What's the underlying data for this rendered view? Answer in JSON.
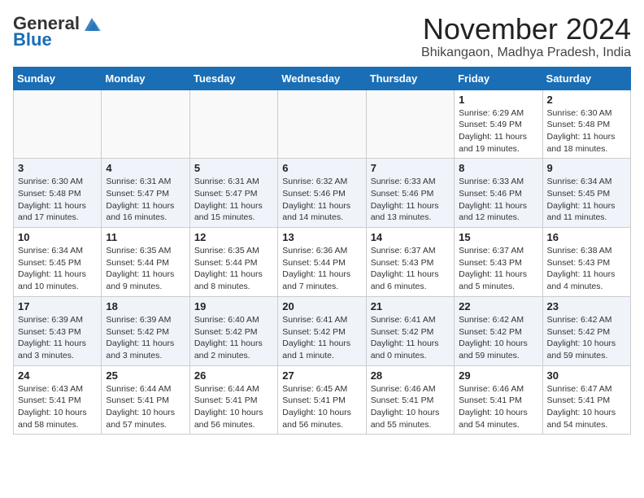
{
  "header": {
    "logo_general": "General",
    "logo_blue": "Blue",
    "month_title": "November 2024",
    "location": "Bhikangaon, Madhya Pradesh, India"
  },
  "days_of_week": [
    "Sunday",
    "Monday",
    "Tuesday",
    "Wednesday",
    "Thursday",
    "Friday",
    "Saturday"
  ],
  "weeks": [
    [
      {
        "day": "",
        "sunrise": "",
        "sunset": "",
        "daylight": ""
      },
      {
        "day": "",
        "sunrise": "",
        "sunset": "",
        "daylight": ""
      },
      {
        "day": "",
        "sunrise": "",
        "sunset": "",
        "daylight": ""
      },
      {
        "day": "",
        "sunrise": "",
        "sunset": "",
        "daylight": ""
      },
      {
        "day": "",
        "sunrise": "",
        "sunset": "",
        "daylight": ""
      },
      {
        "day": "1",
        "sunrise": "Sunrise: 6:29 AM",
        "sunset": "Sunset: 5:49 PM",
        "daylight": "Daylight: 11 hours and 19 minutes."
      },
      {
        "day": "2",
        "sunrise": "Sunrise: 6:30 AM",
        "sunset": "Sunset: 5:48 PM",
        "daylight": "Daylight: 11 hours and 18 minutes."
      }
    ],
    [
      {
        "day": "3",
        "sunrise": "Sunrise: 6:30 AM",
        "sunset": "Sunset: 5:48 PM",
        "daylight": "Daylight: 11 hours and 17 minutes."
      },
      {
        "day": "4",
        "sunrise": "Sunrise: 6:31 AM",
        "sunset": "Sunset: 5:47 PM",
        "daylight": "Daylight: 11 hours and 16 minutes."
      },
      {
        "day": "5",
        "sunrise": "Sunrise: 6:31 AM",
        "sunset": "Sunset: 5:47 PM",
        "daylight": "Daylight: 11 hours and 15 minutes."
      },
      {
        "day": "6",
        "sunrise": "Sunrise: 6:32 AM",
        "sunset": "Sunset: 5:46 PM",
        "daylight": "Daylight: 11 hours and 14 minutes."
      },
      {
        "day": "7",
        "sunrise": "Sunrise: 6:33 AM",
        "sunset": "Sunset: 5:46 PM",
        "daylight": "Daylight: 11 hours and 13 minutes."
      },
      {
        "day": "8",
        "sunrise": "Sunrise: 6:33 AM",
        "sunset": "Sunset: 5:46 PM",
        "daylight": "Daylight: 11 hours and 12 minutes."
      },
      {
        "day": "9",
        "sunrise": "Sunrise: 6:34 AM",
        "sunset": "Sunset: 5:45 PM",
        "daylight": "Daylight: 11 hours and 11 minutes."
      }
    ],
    [
      {
        "day": "10",
        "sunrise": "Sunrise: 6:34 AM",
        "sunset": "Sunset: 5:45 PM",
        "daylight": "Daylight: 11 hours and 10 minutes."
      },
      {
        "day": "11",
        "sunrise": "Sunrise: 6:35 AM",
        "sunset": "Sunset: 5:44 PM",
        "daylight": "Daylight: 11 hours and 9 minutes."
      },
      {
        "day": "12",
        "sunrise": "Sunrise: 6:35 AM",
        "sunset": "Sunset: 5:44 PM",
        "daylight": "Daylight: 11 hours and 8 minutes."
      },
      {
        "day": "13",
        "sunrise": "Sunrise: 6:36 AM",
        "sunset": "Sunset: 5:44 PM",
        "daylight": "Daylight: 11 hours and 7 minutes."
      },
      {
        "day": "14",
        "sunrise": "Sunrise: 6:37 AM",
        "sunset": "Sunset: 5:43 PM",
        "daylight": "Daylight: 11 hours and 6 minutes."
      },
      {
        "day": "15",
        "sunrise": "Sunrise: 6:37 AM",
        "sunset": "Sunset: 5:43 PM",
        "daylight": "Daylight: 11 hours and 5 minutes."
      },
      {
        "day": "16",
        "sunrise": "Sunrise: 6:38 AM",
        "sunset": "Sunset: 5:43 PM",
        "daylight": "Daylight: 11 hours and 4 minutes."
      }
    ],
    [
      {
        "day": "17",
        "sunrise": "Sunrise: 6:39 AM",
        "sunset": "Sunset: 5:43 PM",
        "daylight": "Daylight: 11 hours and 3 minutes."
      },
      {
        "day": "18",
        "sunrise": "Sunrise: 6:39 AM",
        "sunset": "Sunset: 5:42 PM",
        "daylight": "Daylight: 11 hours and 3 minutes."
      },
      {
        "day": "19",
        "sunrise": "Sunrise: 6:40 AM",
        "sunset": "Sunset: 5:42 PM",
        "daylight": "Daylight: 11 hours and 2 minutes."
      },
      {
        "day": "20",
        "sunrise": "Sunrise: 6:41 AM",
        "sunset": "Sunset: 5:42 PM",
        "daylight": "Daylight: 11 hours and 1 minute."
      },
      {
        "day": "21",
        "sunrise": "Sunrise: 6:41 AM",
        "sunset": "Sunset: 5:42 PM",
        "daylight": "Daylight: 11 hours and 0 minutes."
      },
      {
        "day": "22",
        "sunrise": "Sunrise: 6:42 AM",
        "sunset": "Sunset: 5:42 PM",
        "daylight": "Daylight: 10 hours and 59 minutes."
      },
      {
        "day": "23",
        "sunrise": "Sunrise: 6:42 AM",
        "sunset": "Sunset: 5:42 PM",
        "daylight": "Daylight: 10 hours and 59 minutes."
      }
    ],
    [
      {
        "day": "24",
        "sunrise": "Sunrise: 6:43 AM",
        "sunset": "Sunset: 5:41 PM",
        "daylight": "Daylight: 10 hours and 58 minutes."
      },
      {
        "day": "25",
        "sunrise": "Sunrise: 6:44 AM",
        "sunset": "Sunset: 5:41 PM",
        "daylight": "Daylight: 10 hours and 57 minutes."
      },
      {
        "day": "26",
        "sunrise": "Sunrise: 6:44 AM",
        "sunset": "Sunset: 5:41 PM",
        "daylight": "Daylight: 10 hours and 56 minutes."
      },
      {
        "day": "27",
        "sunrise": "Sunrise: 6:45 AM",
        "sunset": "Sunset: 5:41 PM",
        "daylight": "Daylight: 10 hours and 56 minutes."
      },
      {
        "day": "28",
        "sunrise": "Sunrise: 6:46 AM",
        "sunset": "Sunset: 5:41 PM",
        "daylight": "Daylight: 10 hours and 55 minutes."
      },
      {
        "day": "29",
        "sunrise": "Sunrise: 6:46 AM",
        "sunset": "Sunset: 5:41 PM",
        "daylight": "Daylight: 10 hours and 54 minutes."
      },
      {
        "day": "30",
        "sunrise": "Sunrise: 6:47 AM",
        "sunset": "Sunset: 5:41 PM",
        "daylight": "Daylight: 10 hours and 54 minutes."
      }
    ]
  ]
}
